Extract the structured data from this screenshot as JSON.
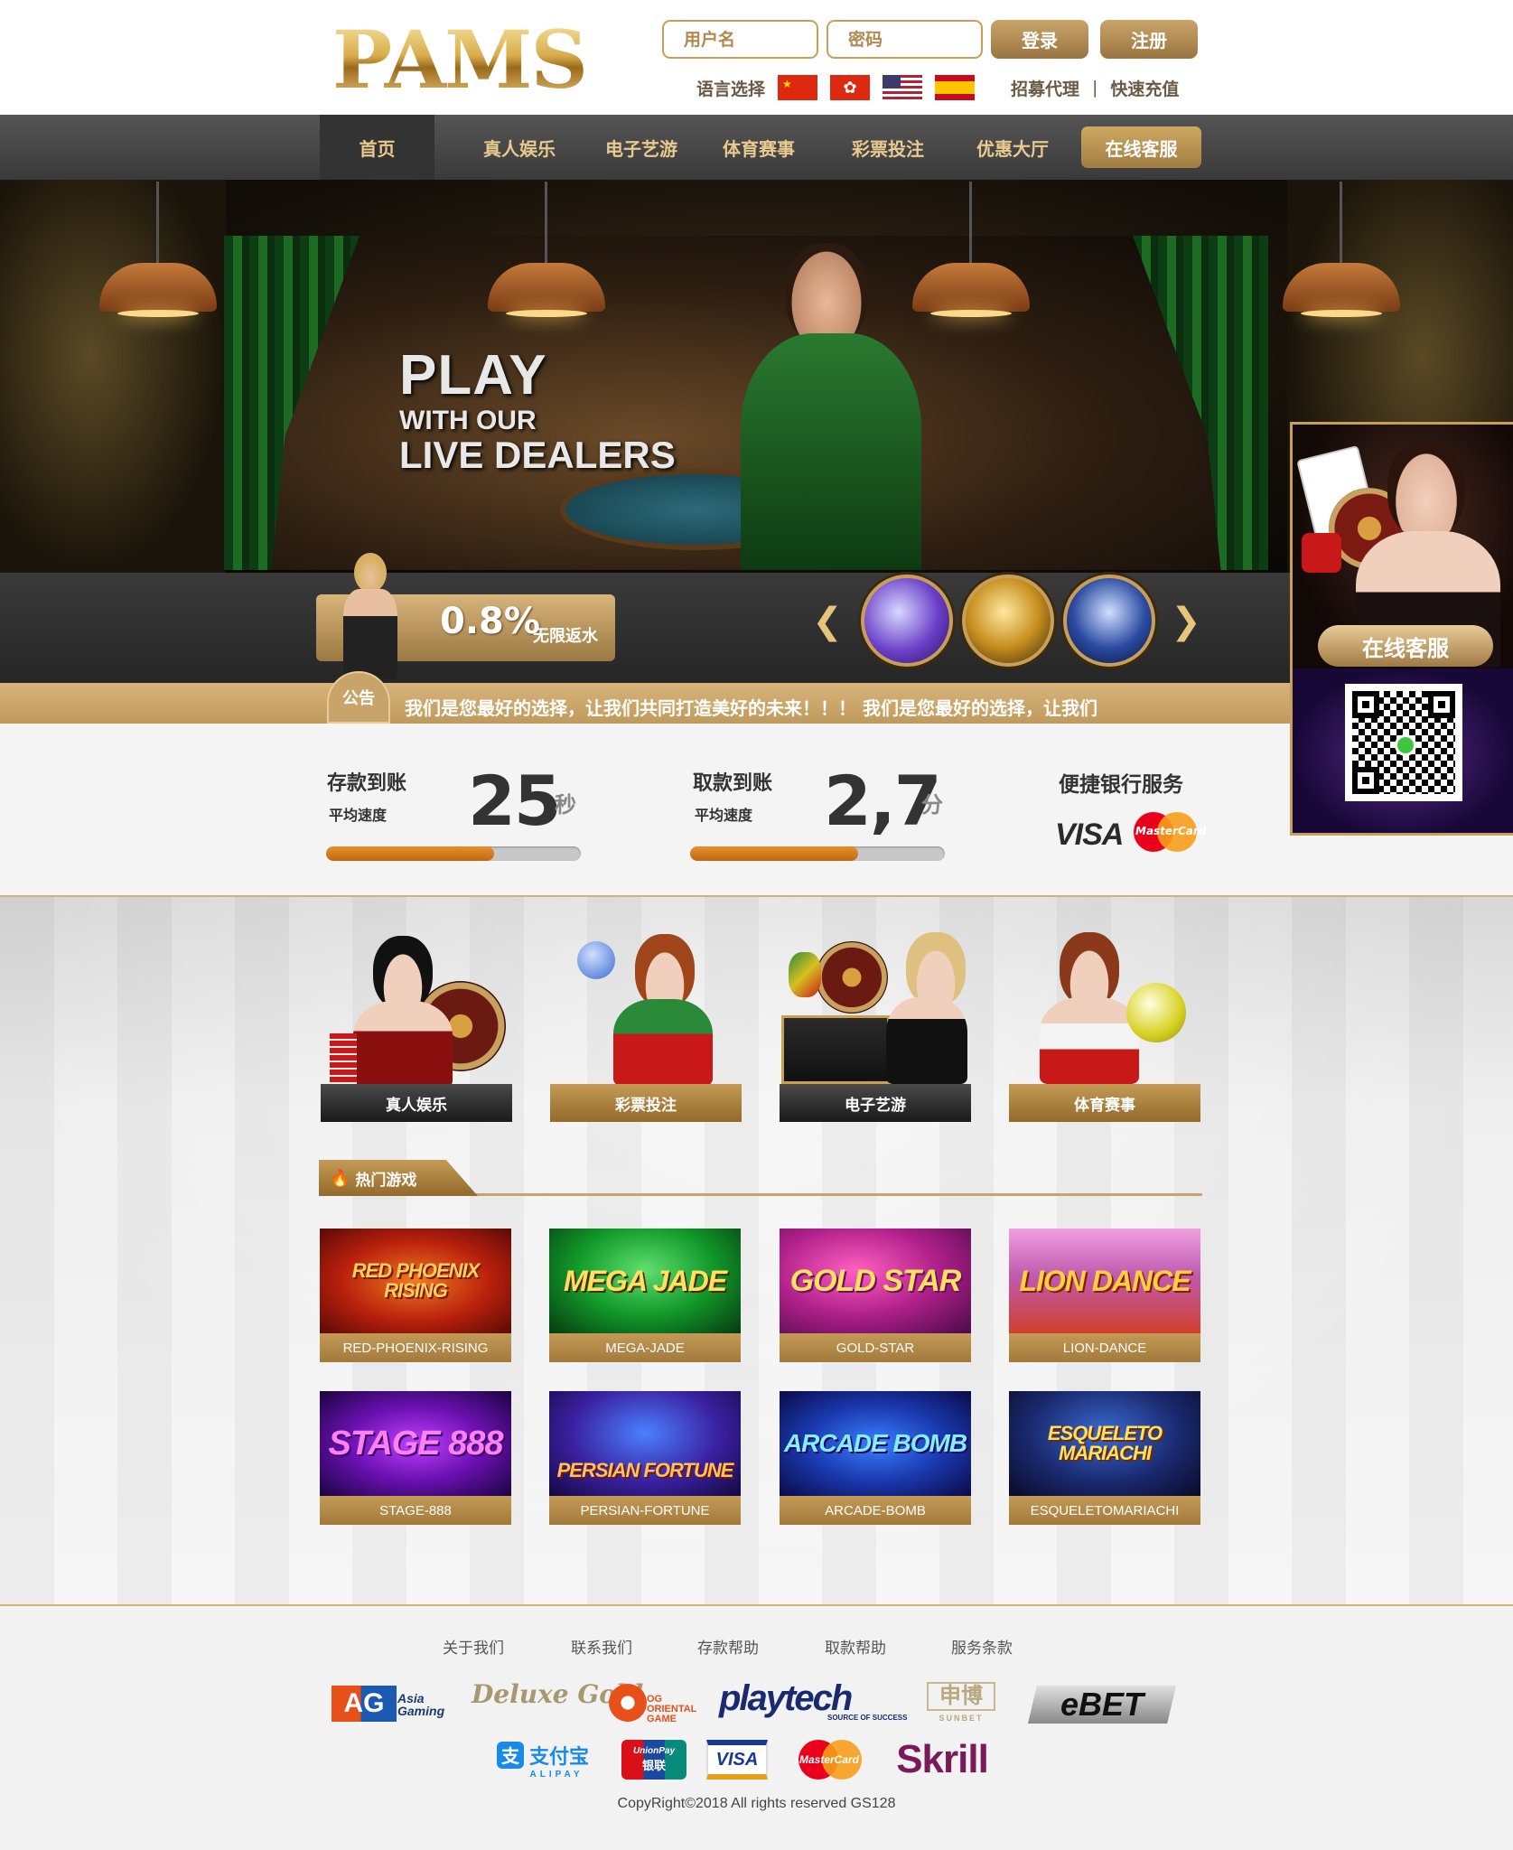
{
  "header": {
    "logo": "PAMS",
    "username_placeholder": "用户名",
    "password_placeholder": "密码",
    "login_label": "登录",
    "register_label": "注册",
    "language_label": "语言选择",
    "flags": [
      "cn-flag-icon",
      "hk-flag-icon",
      "us-flag-icon",
      "es-flag-icon"
    ],
    "links": [
      "招募代理",
      "快速充值"
    ],
    "link_separator": "|"
  },
  "nav": {
    "items": [
      "首页",
      "真人娱乐",
      "电子艺游",
      "体育赛事",
      "彩票投注",
      "优惠大厅"
    ],
    "service_label": "在线客服",
    "active_index": 0
  },
  "banner": {
    "headline_1": "PLAY",
    "headline_2": "WITH OUR",
    "headline_3": "LIVE DEALERS"
  },
  "rebate": {
    "percent": "0.8%",
    "text": "无限返水"
  },
  "carousel": {
    "prev_icon": "chevron-left-icon",
    "next_icon": "chevron-right-icon",
    "thumbs": [
      "poker-chip-thumb",
      "roulette-ball-thumb",
      "slot-machine-thumb"
    ]
  },
  "notice": {
    "badge": "公告",
    "text": "我们是您最好的选择，让我们共同打造美好的未来！！！      我们是您最好的选择，让我们"
  },
  "floating_service": {
    "label": "在线客服",
    "qr_icon": "wechat-qr-icon"
  },
  "stats": {
    "deposit": {
      "title": "存款到账",
      "sub": "平均速度",
      "value": "25",
      "unit": "秒",
      "progress": 0.66
    },
    "withdraw": {
      "title": "取款到账",
      "sub": "平均速度",
      "value": "2,7",
      "unit": "分",
      "progress": 0.66
    },
    "bank": {
      "title": "便捷银行服务",
      "visa": "VISA",
      "mastercard": "MasterCard"
    }
  },
  "categories": [
    {
      "label": "真人娱乐",
      "style": "dark"
    },
    {
      "label": "彩票投注",
      "style": "gold"
    },
    {
      "label": "电子艺游",
      "style": "dark"
    },
    {
      "label": "体育赛事",
      "style": "gold"
    }
  ],
  "hot_games": {
    "title": "热门游戏",
    "games": [
      {
        "title": "RED PHOENIX RISING",
        "label": "RED-PHOENIX-RISING"
      },
      {
        "title": "MEGA JADE",
        "label": "MEGA-JADE"
      },
      {
        "title": "GOLD STAR",
        "label": "GOLD-STAR"
      },
      {
        "title": "LION DANCE",
        "label": "LION-DANCE"
      },
      {
        "title": "STAGE 888",
        "label": "STAGE-888"
      },
      {
        "title": "PERSIAN FORTUNE",
        "label": "PERSIAN-FORTUNE"
      },
      {
        "title": "ARCADE BOMB",
        "label": "ARCADE-BOMB"
      },
      {
        "title": "ESQUELETO MARIACHI",
        "label": "ESQUELETOMARIACHI"
      }
    ]
  },
  "footer": {
    "links": [
      "关于我们",
      "联系我们",
      "存款帮助",
      "取款帮助",
      "服务条款"
    ],
    "providers": [
      "AG",
      "Asia Gaming",
      "Deluxe Gold",
      "OG ORIENTAL GAME",
      "playtech",
      "SOURCE OF SUCCESS",
      "申博",
      "SUNBET",
      "eBET"
    ],
    "payments": [
      "支付宝",
      "ALIPAY",
      "UnionPay",
      "银联",
      "VISA",
      "MasterCard",
      "Skrill"
    ],
    "copyright": "CopyRight©2018 All rights reserved GS128"
  },
  "colors": {
    "gold": "#c9a46a",
    "gold_dark": "#9a7540",
    "nav_bg": "#444444",
    "progress": "#e08a22"
  }
}
